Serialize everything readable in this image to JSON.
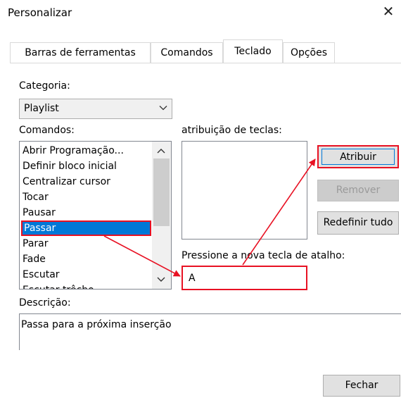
{
  "window": {
    "title": "Personalizar",
    "close_glyph": "✕"
  },
  "tabs": [
    {
      "label": "Barras de ferramentas"
    },
    {
      "label": "Comandos"
    },
    {
      "label": "Teclado"
    },
    {
      "label": "Opções"
    }
  ],
  "categoria": {
    "label": "Categoria:",
    "selected": "Playlist"
  },
  "comandos": {
    "label": "Comandos:",
    "items": [
      "Abrir Programação...",
      "Definir bloco inicial",
      "Centralizar cursor",
      "Tocar",
      "Pausar",
      "Passar",
      "Parar",
      "Fade",
      "Escutar",
      "Escutar trêcho"
    ],
    "selected": "Passar"
  },
  "atribuicao": {
    "label": "atribuição de teclas:"
  },
  "buttons": {
    "atribuir": "Atribuir",
    "remover": "Remover",
    "redefinir": "Redefinir tudo",
    "fechar": "Fechar"
  },
  "atalho": {
    "label": "Pressione a nova tecla de atalho:",
    "value": "A"
  },
  "descricao": {
    "label": "Descrição:",
    "value": "Passa para a próxima inserção"
  },
  "colors": {
    "annotation": "#e81123",
    "selection": "#0078d7"
  }
}
